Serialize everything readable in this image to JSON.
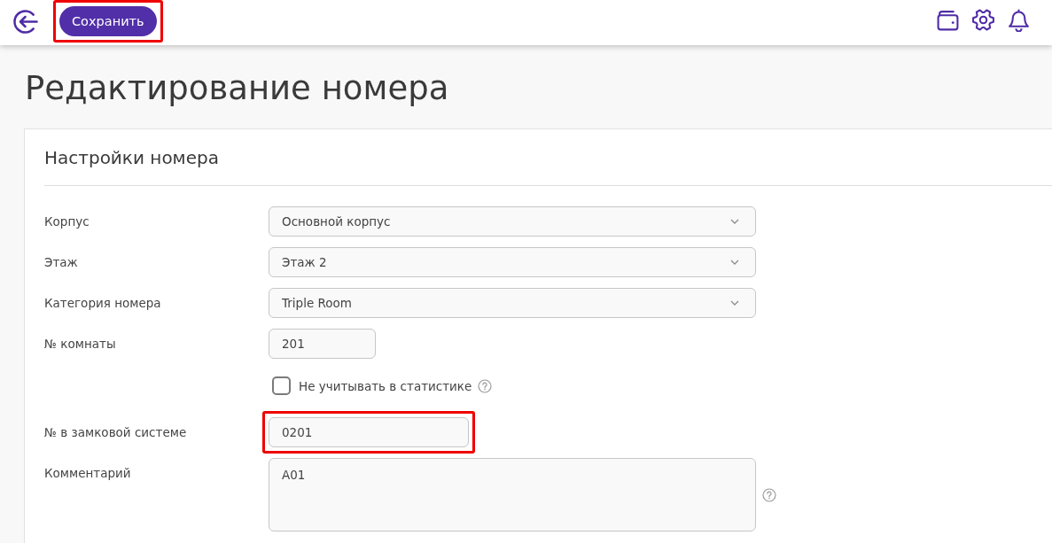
{
  "header": {
    "save_button": {
      "label": "Сохранить",
      "highlighted": true
    }
  },
  "page_title": "Редактирование номера",
  "settings": {
    "title": "Настройки номера",
    "fields": [
      {
        "kind": "select",
        "label": "Корпус",
        "value": "Основной корпус",
        "highlighted": false,
        "help": false
      },
      {
        "kind": "select",
        "label": "Этаж",
        "value": "Этаж 2",
        "highlighted": false,
        "help": false
      },
      {
        "kind": "select",
        "label": "Категория номера",
        "value": "Triple Room",
        "highlighted": false,
        "help": false
      },
      {
        "kind": "short-input",
        "label": "№ комнаты",
        "value": "201",
        "highlighted": false,
        "help": false
      },
      {
        "kind": "checkbox",
        "label": "Не учитывать в статистике",
        "checked": false,
        "highlighted": false,
        "help": true
      },
      {
        "kind": "input",
        "label": "№ в замковой системе",
        "value": "0201",
        "highlighted": true,
        "help": false
      },
      {
        "kind": "textarea",
        "label": "Комментарий",
        "value": "A01",
        "highlighted": false,
        "help": true
      }
    ]
  }
}
